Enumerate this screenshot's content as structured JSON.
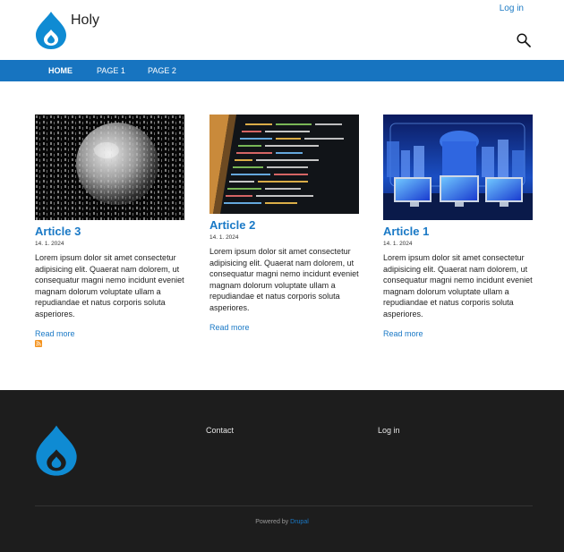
{
  "header": {
    "site_name": "Holy",
    "login": "Log in",
    "logo_icon": "drupal-drop-icon",
    "search_icon": "search-icon"
  },
  "nav": {
    "items": [
      {
        "label": "HOME",
        "active": true
      },
      {
        "label": "PAGE 1",
        "active": false
      },
      {
        "label": "PAGE 2",
        "active": false
      }
    ]
  },
  "articles": [
    {
      "title": "Article 3",
      "date": "14. 1. 2024",
      "body": "Lorem ipsum dolor sit amet consectetur adipisicing elit. Quaerat nam dolorem, ut consequatur magni nemo incidunt eveniet magnam dolorum voluptate ullam a repudiandae et natus corporis soluta asperiores.",
      "read_more": "Read more",
      "image": "binary-sphere-image"
    },
    {
      "title": "Article 2",
      "date": "14. 1. 2024",
      "body": "Lorem ipsum dolor sit amet consectetur adipisicing elit. Quaerat nam dolorem, ut consequatur magni nemo incidunt eveniet magnam dolorum voluptate ullam a repudiandae et natus corporis soluta asperiores.",
      "read_more": "Read more",
      "image": "code-on-laptop-image"
    },
    {
      "title": "Article 1",
      "date": "14. 1. 2024",
      "body": "Lorem ipsum dolor sit amet consectetur adipisicing elit. Quaerat nam dolorem, ut consequatur magni nemo incidunt eveniet magnam dolorum voluptate ullam a repudiandae et natus corporis soluta asperiores.",
      "read_more": "Read more",
      "image": "city-monitors-image"
    }
  ],
  "feed_icon": "rss-icon",
  "footer": {
    "contact": "Contact",
    "login": "Log in",
    "powered_prefix": "Powered by",
    "powered_link": "Drupal"
  },
  "colors": {
    "brand_blue": "#1774c0",
    "link_blue": "#1a79c6",
    "drop_blue": "#0f8bd3",
    "footer_bg": "#1d1d1d"
  }
}
